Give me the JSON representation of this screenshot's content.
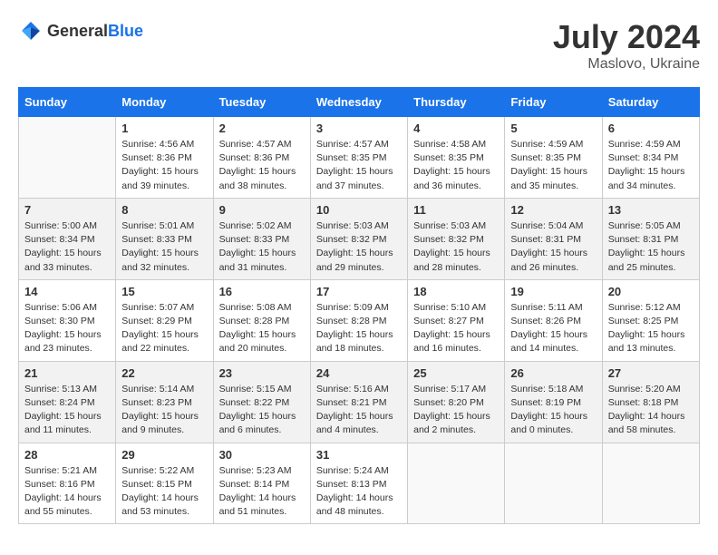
{
  "header": {
    "logo_general": "General",
    "logo_blue": "Blue",
    "month_year": "July 2024",
    "location": "Maslovo, Ukraine"
  },
  "calendar": {
    "days_of_week": [
      "Sunday",
      "Monday",
      "Tuesday",
      "Wednesday",
      "Thursday",
      "Friday",
      "Saturday"
    ],
    "weeks": [
      [
        {
          "day": "",
          "info": ""
        },
        {
          "day": "1",
          "info": "Sunrise: 4:56 AM\nSunset: 8:36 PM\nDaylight: 15 hours\nand 39 minutes."
        },
        {
          "day": "2",
          "info": "Sunrise: 4:57 AM\nSunset: 8:36 PM\nDaylight: 15 hours\nand 38 minutes."
        },
        {
          "day": "3",
          "info": "Sunrise: 4:57 AM\nSunset: 8:35 PM\nDaylight: 15 hours\nand 37 minutes."
        },
        {
          "day": "4",
          "info": "Sunrise: 4:58 AM\nSunset: 8:35 PM\nDaylight: 15 hours\nand 36 minutes."
        },
        {
          "day": "5",
          "info": "Sunrise: 4:59 AM\nSunset: 8:35 PM\nDaylight: 15 hours\nand 35 minutes."
        },
        {
          "day": "6",
          "info": "Sunrise: 4:59 AM\nSunset: 8:34 PM\nDaylight: 15 hours\nand 34 minutes."
        }
      ],
      [
        {
          "day": "7",
          "info": "Sunrise: 5:00 AM\nSunset: 8:34 PM\nDaylight: 15 hours\nand 33 minutes."
        },
        {
          "day": "8",
          "info": "Sunrise: 5:01 AM\nSunset: 8:33 PM\nDaylight: 15 hours\nand 32 minutes."
        },
        {
          "day": "9",
          "info": "Sunrise: 5:02 AM\nSunset: 8:33 PM\nDaylight: 15 hours\nand 31 minutes."
        },
        {
          "day": "10",
          "info": "Sunrise: 5:03 AM\nSunset: 8:32 PM\nDaylight: 15 hours\nand 29 minutes."
        },
        {
          "day": "11",
          "info": "Sunrise: 5:03 AM\nSunset: 8:32 PM\nDaylight: 15 hours\nand 28 minutes."
        },
        {
          "day": "12",
          "info": "Sunrise: 5:04 AM\nSunset: 8:31 PM\nDaylight: 15 hours\nand 26 minutes."
        },
        {
          "day": "13",
          "info": "Sunrise: 5:05 AM\nSunset: 8:31 PM\nDaylight: 15 hours\nand 25 minutes."
        }
      ],
      [
        {
          "day": "14",
          "info": "Sunrise: 5:06 AM\nSunset: 8:30 PM\nDaylight: 15 hours\nand 23 minutes."
        },
        {
          "day": "15",
          "info": "Sunrise: 5:07 AM\nSunset: 8:29 PM\nDaylight: 15 hours\nand 22 minutes."
        },
        {
          "day": "16",
          "info": "Sunrise: 5:08 AM\nSunset: 8:28 PM\nDaylight: 15 hours\nand 20 minutes."
        },
        {
          "day": "17",
          "info": "Sunrise: 5:09 AM\nSunset: 8:28 PM\nDaylight: 15 hours\nand 18 minutes."
        },
        {
          "day": "18",
          "info": "Sunrise: 5:10 AM\nSunset: 8:27 PM\nDaylight: 15 hours\nand 16 minutes."
        },
        {
          "day": "19",
          "info": "Sunrise: 5:11 AM\nSunset: 8:26 PM\nDaylight: 15 hours\nand 14 minutes."
        },
        {
          "day": "20",
          "info": "Sunrise: 5:12 AM\nSunset: 8:25 PM\nDaylight: 15 hours\nand 13 minutes."
        }
      ],
      [
        {
          "day": "21",
          "info": "Sunrise: 5:13 AM\nSunset: 8:24 PM\nDaylight: 15 hours\nand 11 minutes."
        },
        {
          "day": "22",
          "info": "Sunrise: 5:14 AM\nSunset: 8:23 PM\nDaylight: 15 hours\nand 9 minutes."
        },
        {
          "day": "23",
          "info": "Sunrise: 5:15 AM\nSunset: 8:22 PM\nDaylight: 15 hours\nand 6 minutes."
        },
        {
          "day": "24",
          "info": "Sunrise: 5:16 AM\nSunset: 8:21 PM\nDaylight: 15 hours\nand 4 minutes."
        },
        {
          "day": "25",
          "info": "Sunrise: 5:17 AM\nSunset: 8:20 PM\nDaylight: 15 hours\nand 2 minutes."
        },
        {
          "day": "26",
          "info": "Sunrise: 5:18 AM\nSunset: 8:19 PM\nDaylight: 15 hours\nand 0 minutes."
        },
        {
          "day": "27",
          "info": "Sunrise: 5:20 AM\nSunset: 8:18 PM\nDaylight: 14 hours\nand 58 minutes."
        }
      ],
      [
        {
          "day": "28",
          "info": "Sunrise: 5:21 AM\nSunset: 8:16 PM\nDaylight: 14 hours\nand 55 minutes."
        },
        {
          "day": "29",
          "info": "Sunrise: 5:22 AM\nSunset: 8:15 PM\nDaylight: 14 hours\nand 53 minutes."
        },
        {
          "day": "30",
          "info": "Sunrise: 5:23 AM\nSunset: 8:14 PM\nDaylight: 14 hours\nand 51 minutes."
        },
        {
          "day": "31",
          "info": "Sunrise: 5:24 AM\nSunset: 8:13 PM\nDaylight: 14 hours\nand 48 minutes."
        },
        {
          "day": "",
          "info": ""
        },
        {
          "day": "",
          "info": ""
        },
        {
          "day": "",
          "info": ""
        }
      ]
    ]
  }
}
